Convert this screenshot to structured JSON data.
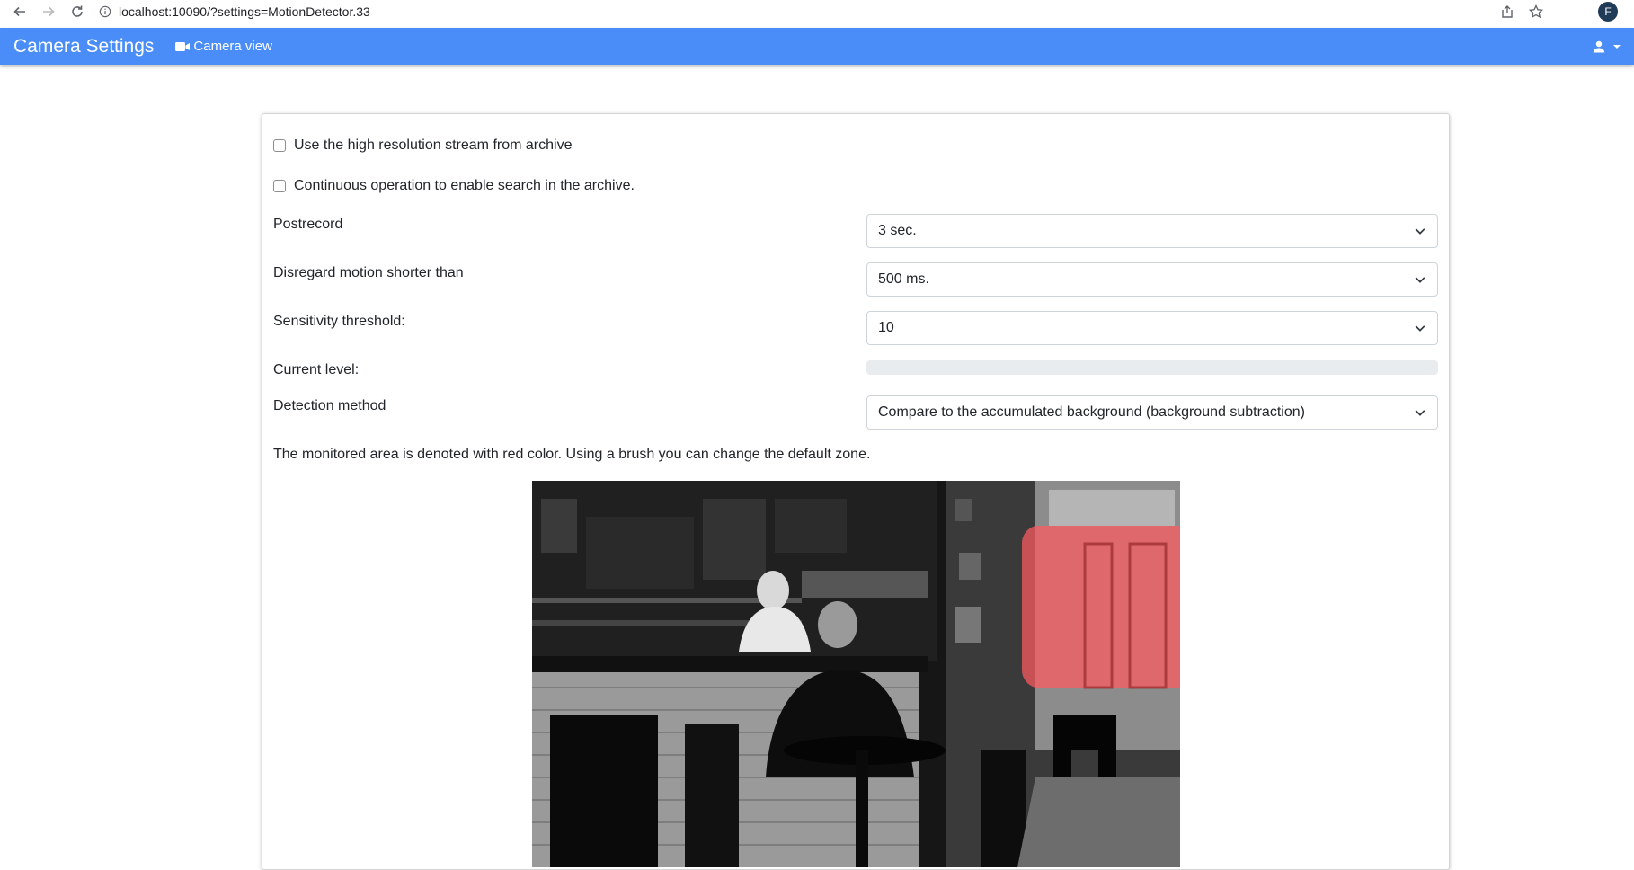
{
  "browser": {
    "url": "localhost:10090/?settings=MotionDetector.33",
    "profile_initial": "F"
  },
  "navbar": {
    "brand": "Camera Settings",
    "camera_view_label": "Camera view"
  },
  "settings": {
    "high_res_label": "Use the high resolution stream from archive",
    "high_res_checked": false,
    "continuous_label": "Continuous operation to enable search in the archive.",
    "continuous_checked": false,
    "postrecord_label": "Postrecord",
    "postrecord_value": "3 sec.",
    "disregard_label": "Disregard motion shorter than",
    "disregard_value": "500 ms.",
    "sensitivity_label": "Sensitivity threshold:",
    "sensitivity_value": "10",
    "current_level_label": "Current level:",
    "current_level_fraction": 0,
    "detection_label": "Detection method",
    "detection_value": "Compare to the accumulated background (background subtraction)",
    "zone_hint": "The monitored area is denoted with red color. Using a brush you can change the default zone."
  },
  "colors": {
    "navbar": "#4a8df8",
    "zone": "#ff5a5f"
  },
  "icons": {
    "back": "arrow-left-icon",
    "forward": "arrow-right-icon",
    "reload": "reload-icon",
    "info": "info-icon",
    "share": "share-icon",
    "star": "star-icon",
    "camera": "video-camera-icon",
    "user": "user-icon",
    "caret": "caret-down-icon",
    "select_chevron": "chevron-down-icon"
  }
}
